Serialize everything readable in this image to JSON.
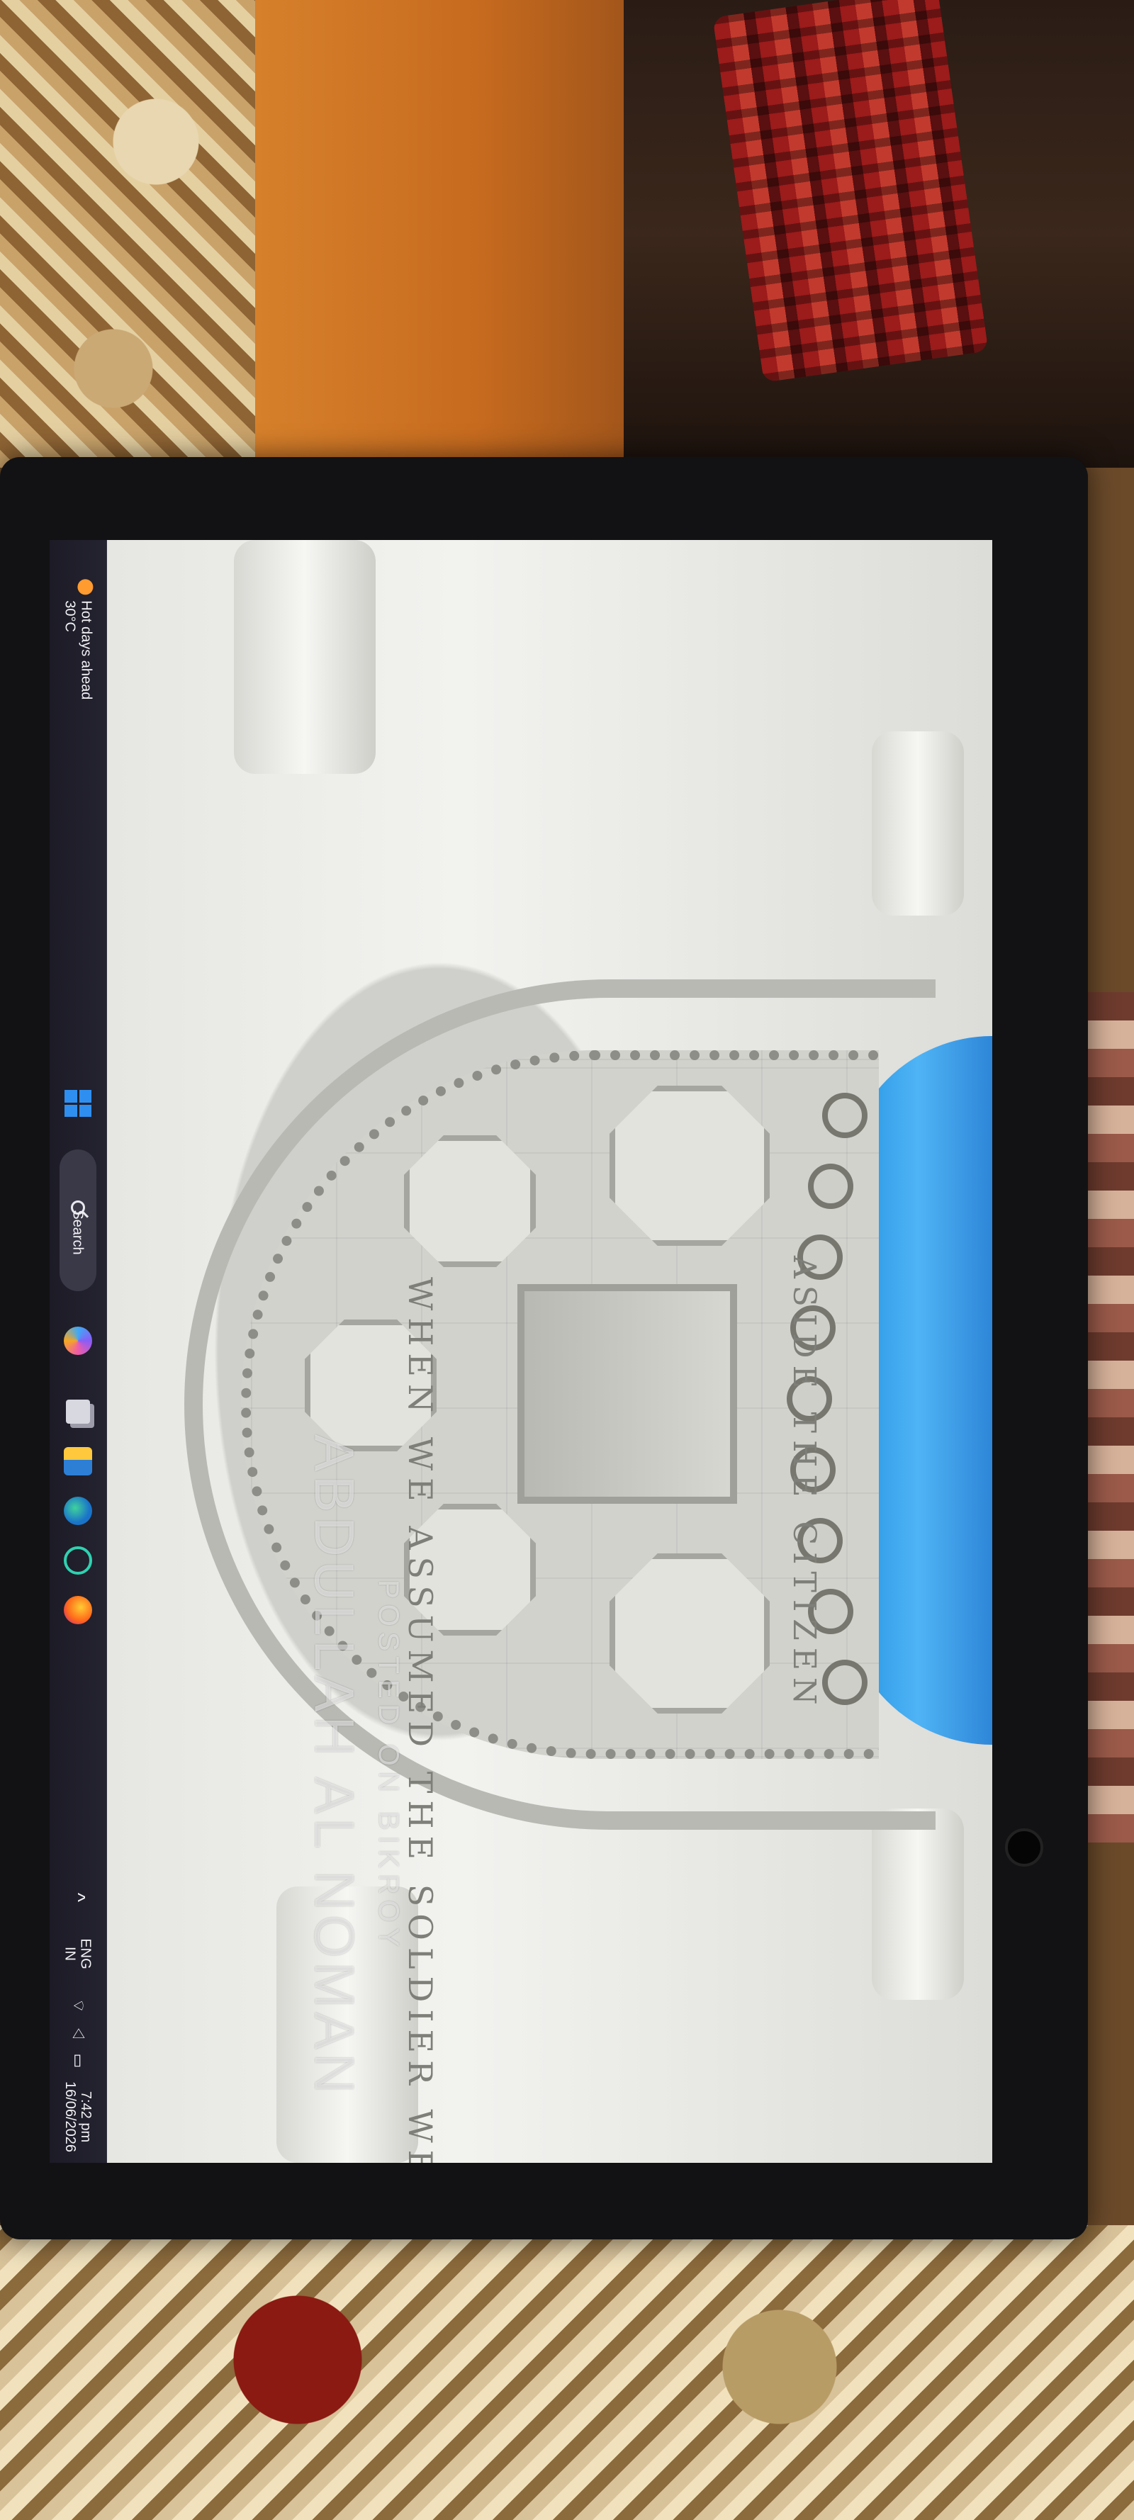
{
  "taskbar": {
    "weather": {
      "text": "Hot days ahead",
      "temperature": "30°C",
      "icon": "thermometer-sun-icon"
    },
    "start_icon": "windows-start-icon",
    "search": {
      "label": "Search",
      "icon": "search-icon"
    },
    "pinned_apps": [
      {
        "name": "copilot-icon"
      },
      {
        "name": "task-view-icon"
      },
      {
        "name": "file-explorer-icon"
      },
      {
        "name": "edge-icon"
      },
      {
        "name": "clock-app-icon"
      },
      {
        "name": "firefox-icon"
      }
    ],
    "overflow_chevron": "^",
    "language": {
      "line1": "ENG",
      "line2": "IN"
    },
    "systray_icons": [
      "wifi-icon",
      "volume-icon",
      "battery-icon"
    ],
    "systray_glyphs": "⌔ ◁ ▭",
    "clock": {
      "time": "7:42 pm",
      "date": "16/06/2026"
    }
  },
  "wallpaper": {
    "inscription_1": "WHEN WE ASSUMED THE SOLDIER WE DID NOT LAY",
    "inscription_2": "ASIDE THE CITIZEN"
  },
  "watermark": {
    "line1": "POSTED ON BIKROY",
    "line2": "ABDULLAH AL NOMAN"
  },
  "colors": {
    "taskbar_bg": "#242330",
    "sky": "#4fb4f5",
    "start_blue": "#2f8ff0"
  }
}
